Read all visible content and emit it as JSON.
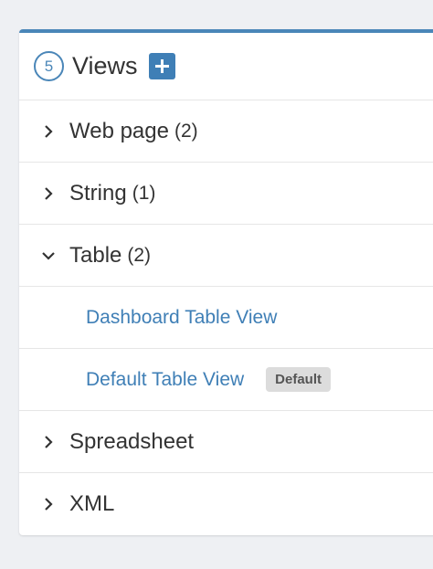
{
  "header": {
    "count": "5",
    "title": "Views"
  },
  "groups": [
    {
      "label": "Web page",
      "count": "(2)",
      "expanded": false
    },
    {
      "label": "String",
      "count": "(1)",
      "expanded": false
    },
    {
      "label": "Table",
      "count": "(2)",
      "expanded": true
    },
    {
      "label": "Spreadsheet",
      "count": "",
      "expanded": false
    },
    {
      "label": "XML",
      "count": "",
      "expanded": false
    }
  ],
  "table_views": [
    {
      "label": "Dashboard Table View",
      "badge": ""
    },
    {
      "label": "Default Table View",
      "badge": "Default"
    }
  ],
  "icons": {
    "add": "plus-icon",
    "collapsed": "chevron-right-icon",
    "expanded": "chevron-down-icon"
  },
  "colors": {
    "accent": "#3f7fb6",
    "top_border": "#4a86b8",
    "badge_bg": "#dcdcdc"
  }
}
